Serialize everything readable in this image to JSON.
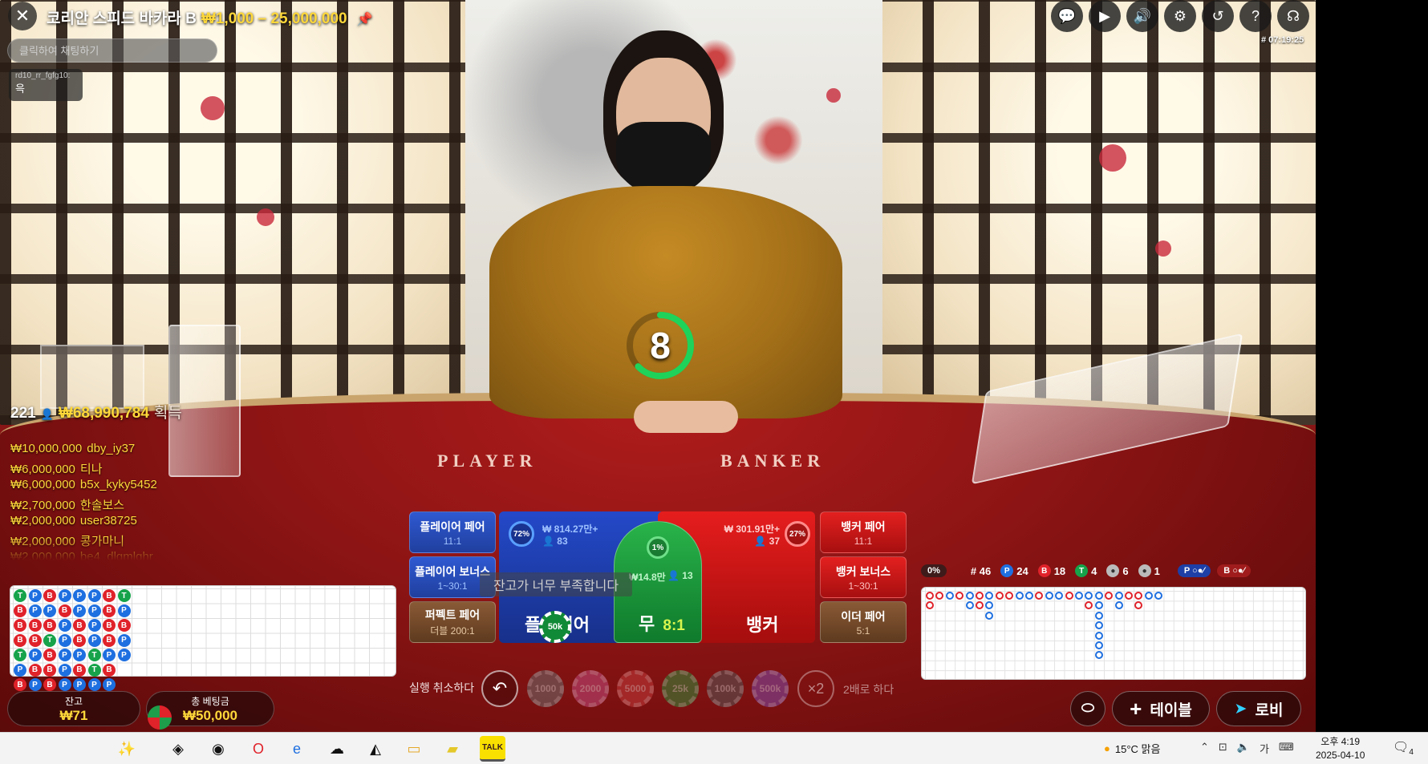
{
  "header": {
    "table_name": "코리안 스피드 바카라 B",
    "bet_limits": "₩1,000 – 25,000,000",
    "round_id": "# 07:19:25"
  },
  "top_icons": [
    "chat-icon",
    "video-icon",
    "sound-icon",
    "settings-icon",
    "history-icon",
    "help-icon",
    "headset-icon"
  ],
  "chat": {
    "placeholder": "클릭하여 채팅하기",
    "last_user": "rd10_rr_fgfg10:",
    "last_message": "윽"
  },
  "scene": {
    "player_word": "PLAYER",
    "banker_word": "BANKER"
  },
  "timer": {
    "value": "8"
  },
  "winners": {
    "count": "221",
    "total": "₩68,990,784",
    "suffix": "획득",
    "list": [
      {
        "amount": "₩10,000,000",
        "name": "dby_iy37"
      },
      {
        "amount": "₩6,000,000",
        "name": "티나"
      },
      {
        "amount": "₩6,000,000",
        "name": "b5x_kyky5452"
      },
      {
        "amount": "₩2,700,000",
        "name": "한솔보스"
      },
      {
        "amount": "₩2,000,000",
        "name": "user38725"
      },
      {
        "amount": "₩2,000,000",
        "name": "콩가마니"
      },
      {
        "amount": "₩2,000,000",
        "name": "be4_dlgmlghr"
      }
    ]
  },
  "bead_road": {
    "columns": [
      [
        "T",
        "B",
        "B",
        "B",
        "T",
        "P",
        "B"
      ],
      [
        "P",
        "P",
        "B",
        "B",
        "P",
        "B",
        "P"
      ],
      [
        "B",
        "P",
        "B",
        "T",
        "B",
        "B",
        "B"
      ],
      [
        "P",
        "B",
        "P",
        "P",
        "P",
        "P",
        "P"
      ],
      [
        "P",
        "P",
        "B",
        "B",
        "P",
        "B",
        "P"
      ],
      [
        "P",
        "P",
        "P",
        "P",
        "T",
        "T",
        "P"
      ],
      [
        "B",
        "B",
        "B",
        "B",
        "P",
        "B",
        "P"
      ],
      [
        "T",
        "P",
        "B",
        "P",
        "P",
        "",
        ""
      ]
    ]
  },
  "bets": {
    "player_pair": {
      "label": "플레이어 페어",
      "odds": "11:1"
    },
    "player_bonus": {
      "label": "플레이어 보너스",
      "odds": "1~30:1"
    },
    "perfect_pair": {
      "label": "퍼펙트 페어",
      "odds": "더블 200:1"
    },
    "banker_pair": {
      "label": "뱅커 페어",
      "odds": "11:1"
    },
    "banker_bonus": {
      "label": "뱅커 보너스",
      "odds": "1~30:1"
    },
    "either_pair": {
      "label": "이더 페어",
      "odds": "5:1"
    },
    "player": {
      "label": "플레이어",
      "pct": "72%",
      "amount": "₩ 814.27만+",
      "players": "83"
    },
    "tie": {
      "label": "무",
      "odds": "8:1",
      "pct": "1%",
      "amount": "₩14.8만",
      "players": "13"
    },
    "banker": {
      "label": "뱅커",
      "pct": "27%",
      "amount": "₩ 301.91만+",
      "players": "37"
    },
    "insufficient_msg": "잔고가 너무 부족합니다",
    "placed_chip": "50k"
  },
  "chips": {
    "undo_label": "실행 취소하다",
    "values": [
      "1000",
      "2000",
      "5000",
      "25k",
      "100k",
      "500k"
    ],
    "colors": [
      "#6b6b6b",
      "#c04b7d",
      "#c23a3a",
      "#2f8a3a",
      "#555555",
      "#7e4aa8"
    ],
    "double": "×2",
    "double_label": "2배로 하다"
  },
  "roadmap_stats": {
    "progress": "0%",
    "games": "# 46",
    "player": "24",
    "banker": "18",
    "tie": "4",
    "player_pair": "6",
    "banker_pair": "1",
    "p_label": "P",
    "b_label": "B",
    "t_label": "T"
  },
  "big_road": {
    "columns": [
      [
        "B",
        "B"
      ],
      [
        "B"
      ],
      [
        "P"
      ],
      [
        "B"
      ],
      [
        "P",
        "P"
      ],
      [
        "B",
        "B"
      ],
      [
        "P",
        "P",
        "P"
      ],
      [
        "B"
      ],
      [
        "B"
      ],
      [
        "P"
      ],
      [
        "P"
      ],
      [
        "B"
      ],
      [
        "P"
      ],
      [
        "P"
      ],
      [
        "B"
      ],
      [
        "P"
      ],
      [
        "P",
        "B"
      ],
      [
        "P",
        "P",
        "P",
        "P",
        "P",
        "P",
        "P"
      ],
      [
        "B"
      ],
      [
        "P",
        "P"
      ],
      [
        "B"
      ],
      [
        "B",
        "B"
      ],
      [
        "P"
      ],
      [
        "P"
      ]
    ]
  },
  "balance": {
    "label": "잔고",
    "value": "₩71"
  },
  "total_bet": {
    "label": "총 베팅금",
    "value": "₩50,000"
  },
  "bottom_buttons": {
    "table": "테이블",
    "lobby": "로비"
  },
  "taskbar": {
    "apps": [
      "copilot-icon",
      "chrome-icon",
      "opera-icon",
      "ie-icon",
      "kakao-icon",
      "folder-icon",
      "notes-icon",
      "talk-icon"
    ],
    "weather": "15°C 맑음",
    "ime": "가",
    "time": "오후 4:19",
    "date": "2025-04-10",
    "notifications": "4"
  }
}
